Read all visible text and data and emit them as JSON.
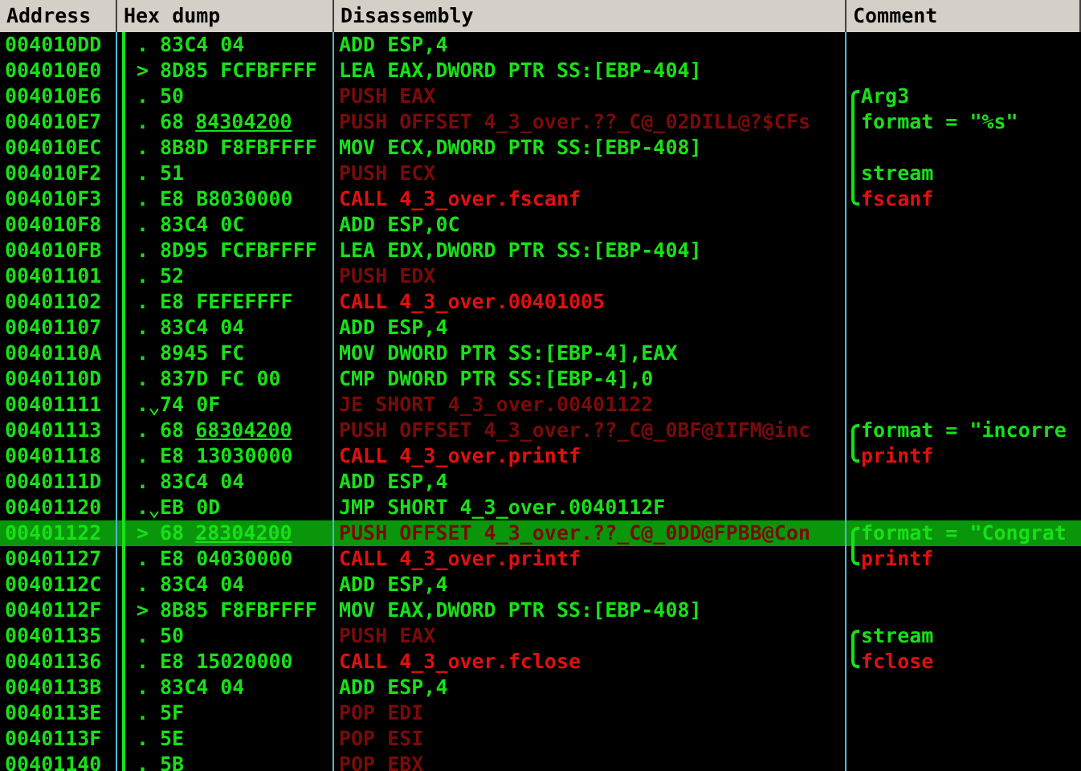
{
  "columns": [
    "Address",
    "Hex dump",
    "Disassembly",
    "Comment"
  ],
  "rows": [
    {
      "address": "004010DD",
      "prefix": ".",
      "jump": false,
      "hex": "83C4 04",
      "asm": "ADD ESP,4",
      "kind": "plain",
      "selected": false
    },
    {
      "address": "004010E0",
      "prefix": ">",
      "jump": false,
      "hex": "8D85 FCFBFFFF",
      "asm": "LEA EAX,DWORD PTR SS:[EBP-404]",
      "kind": "plain",
      "selected": false
    },
    {
      "address": "004010E6",
      "prefix": ".",
      "jump": false,
      "hex": "50",
      "asm": "PUSH EAX",
      "kind": "stack",
      "selected": false,
      "comment": {
        "text": "Arg3",
        "kind": "arg",
        "first": true,
        "last": false
      }
    },
    {
      "address": "004010E7",
      "prefix": ".",
      "jump": false,
      "hex": "68",
      "fixup": "84304200",
      "asm": "PUSH OFFSET 4_3_over.??_C@_02DILL@?$CFs",
      "kind": "stack",
      "selected": false,
      "comment": {
        "text": "format = \"%s\"",
        "kind": "arg",
        "first": false,
        "last": false
      }
    },
    {
      "address": "004010EC",
      "prefix": ".",
      "jump": false,
      "hex": "8B8D F8FBFFFF",
      "asm": "MOV ECX,DWORD PTR SS:[EBP-408]",
      "kind": "plain",
      "selected": false,
      "comment": {
        "first": false,
        "last": false
      }
    },
    {
      "address": "004010F2",
      "prefix": ".",
      "jump": false,
      "hex": "51",
      "asm": "PUSH ECX",
      "kind": "stack",
      "selected": false,
      "comment": {
        "text": "stream",
        "kind": "arg",
        "first": false,
        "last": false
      }
    },
    {
      "address": "004010F3",
      "prefix": ".",
      "jump": false,
      "hex": "E8 B8030000",
      "asm": "CALL 4_3_over.fscanf",
      "kind": "call",
      "selected": false,
      "comment": {
        "text": "fscanf",
        "kind": "func",
        "first": false,
        "last": true
      }
    },
    {
      "address": "004010F8",
      "prefix": ".",
      "jump": false,
      "hex": "83C4 0C",
      "asm": "ADD ESP,0C",
      "kind": "plain",
      "selected": false
    },
    {
      "address": "004010FB",
      "prefix": ".",
      "jump": false,
      "hex": "8D95 FCFBFFFF",
      "asm": "LEA EDX,DWORD PTR SS:[EBP-404]",
      "kind": "plain",
      "selected": false
    },
    {
      "address": "00401101",
      "prefix": ".",
      "jump": false,
      "hex": "52",
      "asm": "PUSH EDX",
      "kind": "stack",
      "selected": false
    },
    {
      "address": "00401102",
      "prefix": ".",
      "jump": false,
      "hex": "E8 FEFEFFFF",
      "asm": "CALL 4_3_over.00401005",
      "kind": "call",
      "selected": false
    },
    {
      "address": "00401107",
      "prefix": ".",
      "jump": false,
      "hex": "83C4 04",
      "asm": "ADD ESP,4",
      "kind": "plain",
      "selected": false
    },
    {
      "address": "0040110A",
      "prefix": ".",
      "jump": false,
      "hex": "8945 FC",
      "asm": "MOV DWORD PTR SS:[EBP-4],EAX",
      "kind": "plain",
      "selected": false
    },
    {
      "address": "0040110D",
      "prefix": ".",
      "jump": false,
      "hex": "837D FC 00",
      "asm": "CMP DWORD PTR SS:[EBP-4],0",
      "kind": "plain",
      "selected": false
    },
    {
      "address": "00401111",
      "prefix": ".",
      "jump": true,
      "hex": "74 0F",
      "asm": "JE SHORT 4_3_over.00401122",
      "kind": "stack",
      "selected": false
    },
    {
      "address": "00401113",
      "prefix": ".",
      "jump": false,
      "hex": "68",
      "fixup": "68304200",
      "asm": "PUSH OFFSET 4_3_over.??_C@_0BF@IIFM@inc",
      "kind": "stack",
      "selected": false,
      "comment": {
        "text": "format = \"incorre",
        "kind": "arg",
        "first": true,
        "last": false
      }
    },
    {
      "address": "00401118",
      "prefix": ".",
      "jump": false,
      "hex": "E8 13030000",
      "asm": "CALL 4_3_over.printf",
      "kind": "call",
      "selected": false,
      "comment": {
        "text": "printf",
        "kind": "func",
        "first": false,
        "last": true
      }
    },
    {
      "address": "0040111D",
      "prefix": ".",
      "jump": false,
      "hex": "83C4 04",
      "asm": "ADD ESP,4",
      "kind": "plain",
      "selected": false
    },
    {
      "address": "00401120",
      "prefix": ".",
      "jump": true,
      "hex": "EB 0D",
      "asm": "JMP SHORT 4_3_over.0040112F",
      "kind": "plain",
      "selected": false
    },
    {
      "address": "00401122",
      "prefix": ">",
      "jump": false,
      "hex": "68",
      "fixup": "28304200",
      "asm": "PUSH OFFSET 4_3_over.??_C@_0DD@FPBB@Con",
      "kind": "stack",
      "selected": true,
      "comment": {
        "text": "format = \"Congrat",
        "kind": "arg",
        "first": true,
        "last": false
      }
    },
    {
      "address": "00401127",
      "prefix": ".",
      "jump": false,
      "hex": "E8 04030000",
      "asm": "CALL 4_3_over.printf",
      "kind": "call",
      "selected": false,
      "comment": {
        "text": "printf",
        "kind": "func",
        "first": false,
        "last": true
      }
    },
    {
      "address": "0040112C",
      "prefix": ".",
      "jump": false,
      "hex": "83C4 04",
      "asm": "ADD ESP,4",
      "kind": "plain",
      "selected": false
    },
    {
      "address": "0040112F",
      "prefix": ">",
      "jump": false,
      "hex": "8B85 F8FBFFFF",
      "asm": "MOV EAX,DWORD PTR SS:[EBP-408]",
      "kind": "plain",
      "selected": false
    },
    {
      "address": "00401135",
      "prefix": ".",
      "jump": false,
      "hex": "50",
      "asm": "PUSH EAX",
      "kind": "stack",
      "selected": false,
      "comment": {
        "text": "stream",
        "kind": "arg",
        "first": true,
        "last": false
      }
    },
    {
      "address": "00401136",
      "prefix": ".",
      "jump": false,
      "hex": "E8 15020000",
      "asm": "CALL 4_3_over.fclose",
      "kind": "call",
      "selected": false,
      "comment": {
        "text": "fclose",
        "kind": "func",
        "first": false,
        "last": true
      }
    },
    {
      "address": "0040113B",
      "prefix": ".",
      "jump": false,
      "hex": "83C4 04",
      "asm": "ADD ESP,4",
      "kind": "plain",
      "selected": false
    },
    {
      "address": "0040113E",
      "prefix": ".",
      "jump": false,
      "hex": "5F",
      "asm": "POP EDI",
      "kind": "stack",
      "selected": false
    },
    {
      "address": "0040113F",
      "prefix": ".",
      "jump": false,
      "hex": "5E",
      "asm": "POP ESI",
      "kind": "stack",
      "selected": false
    },
    {
      "address": "00401140",
      "prefix": ".",
      "jump": false,
      "hex": "5B",
      "asm": "POP EBX",
      "kind": "stack",
      "selected": false
    }
  ]
}
